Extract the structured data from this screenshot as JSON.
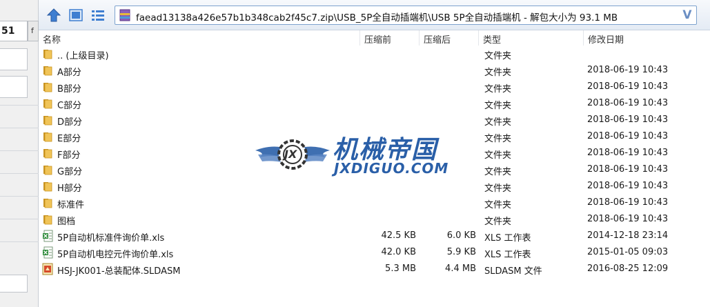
{
  "left_panel": {
    "cell_value": "51",
    "cell_suffix": "f"
  },
  "toolbar": {
    "address": "faead13138a426e57b1b348cab2f45c7.zip\\USB_5P全自动插端机\\USB 5P全自动插端机 - 解包大小为 93.1 MB",
    "drop_glyph": "V"
  },
  "columns": {
    "name": "名称",
    "size": "压缩前",
    "packed": "压缩后",
    "type": "类型",
    "modified": "修改日期"
  },
  "rows": [
    {
      "name": ".. (上级目录)",
      "size": "",
      "packed": "",
      "type": "文件夹",
      "modified": "",
      "icon": "folder-icon"
    },
    {
      "name": "A部分",
      "size": "",
      "packed": "",
      "type": "文件夹",
      "modified": "2018-06-19 10:43",
      "icon": "folder-icon"
    },
    {
      "name": "B部分",
      "size": "",
      "packed": "",
      "type": "文件夹",
      "modified": "2018-06-19 10:43",
      "icon": "folder-icon"
    },
    {
      "name": "C部分",
      "size": "",
      "packed": "",
      "type": "文件夹",
      "modified": "2018-06-19 10:43",
      "icon": "folder-icon"
    },
    {
      "name": "D部分",
      "size": "",
      "packed": "",
      "type": "文件夹",
      "modified": "2018-06-19 10:43",
      "icon": "folder-icon"
    },
    {
      "name": "E部分",
      "size": "",
      "packed": "",
      "type": "文件夹",
      "modified": "2018-06-19 10:43",
      "icon": "folder-icon"
    },
    {
      "name": "F部分",
      "size": "",
      "packed": "",
      "type": "文件夹",
      "modified": "2018-06-19 10:43",
      "icon": "folder-icon"
    },
    {
      "name": "G部分",
      "size": "",
      "packed": "",
      "type": "文件夹",
      "modified": "2018-06-19 10:43",
      "icon": "folder-icon"
    },
    {
      "name": "H部分",
      "size": "",
      "packed": "",
      "type": "文件夹",
      "modified": "2018-06-19 10:43",
      "icon": "folder-icon"
    },
    {
      "name": "标准件",
      "size": "",
      "packed": "",
      "type": "文件夹",
      "modified": "2018-06-19 10:43",
      "icon": "folder-icon"
    },
    {
      "name": "图档",
      "size": "",
      "packed": "",
      "type": "文件夹",
      "modified": "2018-06-19 10:43",
      "icon": "folder-icon"
    },
    {
      "name": "5P自动机标准件询价单.xls",
      "size": "42.5 KB",
      "packed": "6.0 KB",
      "type": "XLS 工作表",
      "modified": "2014-12-18 23:14",
      "icon": "excel-file-icon"
    },
    {
      "name": "5P自动机电控元件询价单.xls",
      "size": "42.0 KB",
      "packed": "5.9 KB",
      "type": "XLS 工作表",
      "modified": "2015-01-05 09:03",
      "icon": "excel-file-icon"
    },
    {
      "name": "HSJ-JK001-总装配体.SLDASM",
      "size": "5.3 MB",
      "packed": "4.4 MB",
      "type": "SLDASM 文件",
      "modified": "2016-08-25 12:09",
      "icon": "solidworks-file-icon"
    }
  ],
  "watermark": {
    "chinese": "机械帝国",
    "english": "JXDIGUO.COM",
    "emblem": "JX"
  },
  "colors": {
    "folder": "#e8b64a",
    "accent": "#2a5fa8",
    "address_border": "#7da2ce"
  }
}
